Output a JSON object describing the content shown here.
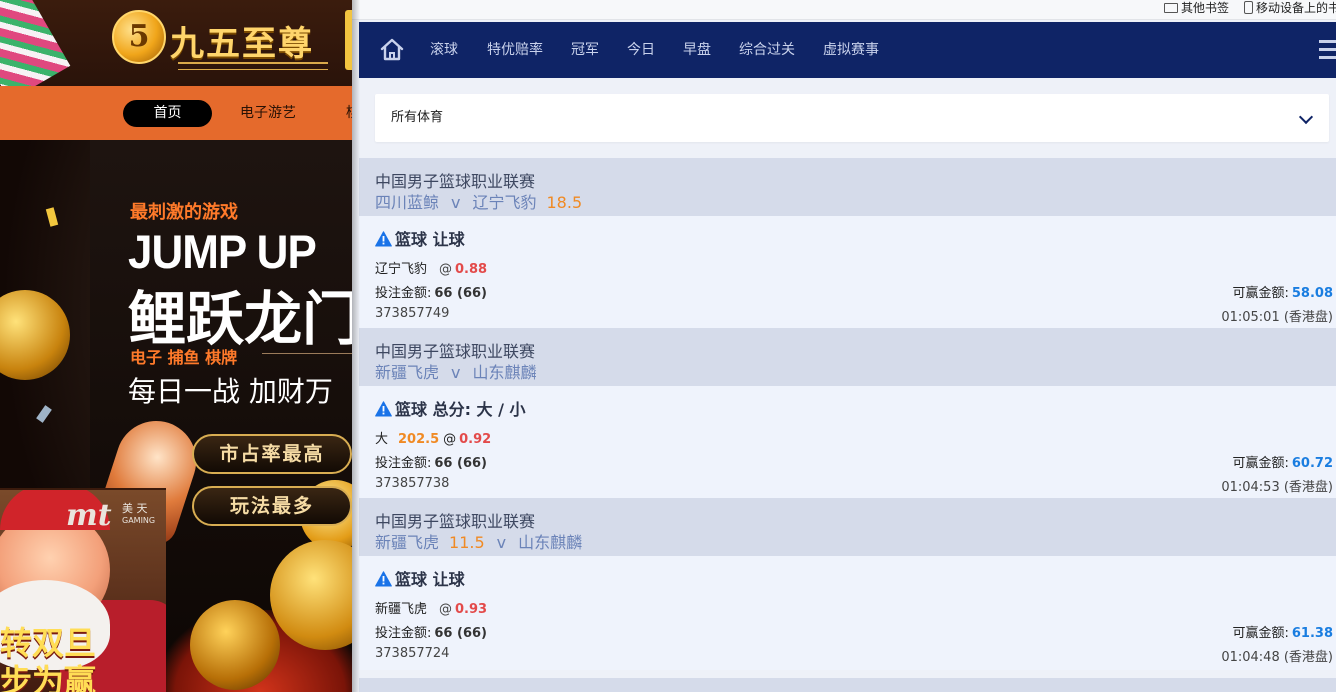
{
  "background_site": {
    "logo_number": "5",
    "logo_text": "九五至尊",
    "nav": {
      "home": "首页",
      "games": "电子游艺",
      "more": "棋"
    },
    "promo": {
      "tag": "最刺激的游戏",
      "title_en": "JUMP UP",
      "title_cn": "鲤跃龙门",
      "categories": "电子  捕鱼  棋牌",
      "slogan": "每日一战  加财万",
      "pill_1": "市占率最高",
      "pill_2": "玩法最多"
    },
    "santa_card": {
      "brand": "mt",
      "brand_cn": "美 天",
      "brand_en": "GAMING",
      "text_line1": "转双旦",
      "text_line2": "步为赢"
    }
  },
  "bookmarks": {
    "other": "其他书签",
    "mobile": "移动设备上的书"
  },
  "topnav": {
    "items": [
      "滚球",
      "特优赔率",
      "冠军",
      "今日",
      "早盘",
      "综合过关",
      "虚拟赛事"
    ]
  },
  "sport_select": {
    "value": "所有体育"
  },
  "bets": [
    {
      "league": "中国男子篮球职业联赛",
      "home": "四川蓝鲸",
      "vs": "v",
      "away": "辽宁飞豹",
      "header_handicap": "18.5",
      "title": "篮球 让球",
      "pick": "辽宁飞豹",
      "at": "@",
      "odds": "0.88",
      "stake_label": "投注金额:",
      "stake": "66 (66)",
      "win_label": "可赢金额:",
      "win": "58.08",
      "ticket_id": "373857749",
      "time": "01:05:01 (香港盘)"
    },
    {
      "league": "中国男子篮球职业联赛",
      "home": "新疆飞虎",
      "vs": "v",
      "away": "山东麒麟",
      "title": "篮球 总分: 大 / 小",
      "pick": "大",
      "line": "202.5",
      "at": "@",
      "odds": "0.92",
      "stake_label": "投注金额:",
      "stake": "66 (66)",
      "win_label": "可赢金额:",
      "win": "60.72",
      "ticket_id": "373857738",
      "time": "01:04:53 (香港盘)"
    },
    {
      "league": "中国男子篮球职业联赛",
      "home": "新疆飞虎",
      "home_handicap": "11.5",
      "vs": "v",
      "away": "山东麒麟",
      "title": "篮球 让球",
      "pick": "新疆飞虎",
      "at": "@",
      "odds": "0.93",
      "stake_label": "投注金额:",
      "stake": "66 (66)",
      "win_label": "可赢金额:",
      "win": "61.38",
      "ticket_id": "373857724",
      "time": "01:04:48 (香港盘)"
    }
  ],
  "colors": {
    "nav_bg": "#0f2466",
    "header_bg": "#d5dbea",
    "body_bg": "#eff3fc",
    "odds": "#e34a4a",
    "handicap": "#f08a24",
    "win": "#1a7de0",
    "warning_icon": "#1a73e8"
  },
  "icons": {
    "home": "home-icon",
    "menu": "hamburger-menu-icon",
    "select": "chevron-down-icon",
    "warning": "warning-triangle-icon",
    "bookmark_folder": "folder-icon",
    "bookmark_mobile": "mobile-device-icon"
  }
}
